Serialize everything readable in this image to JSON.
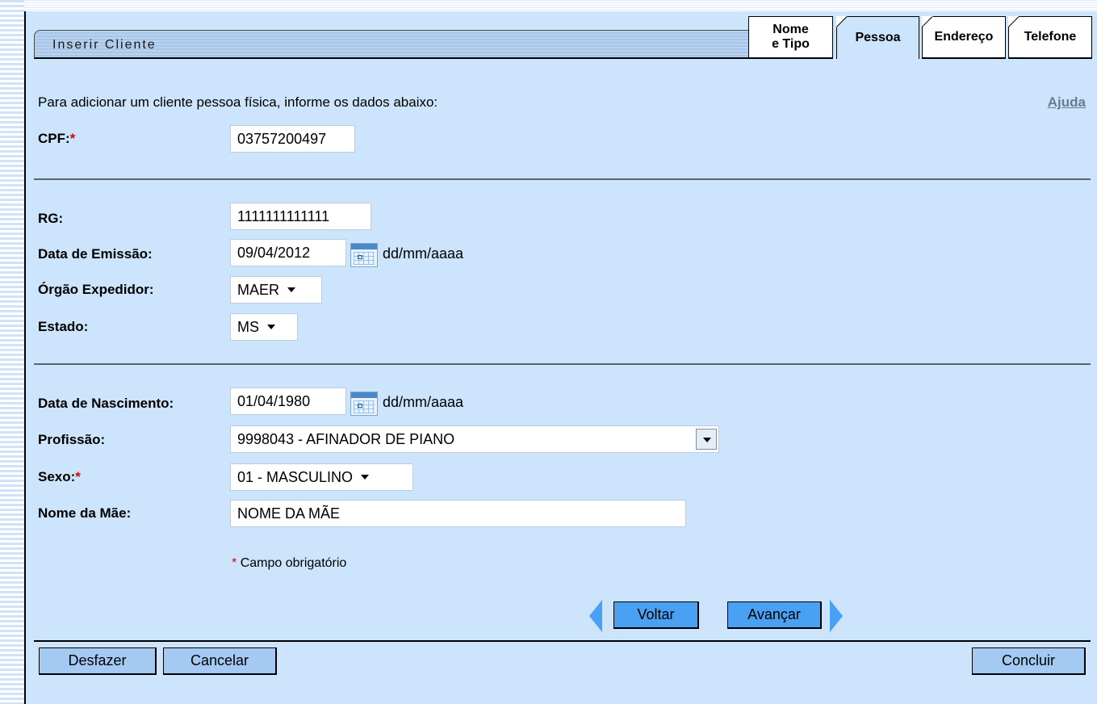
{
  "header": {
    "title": "Inserir Cliente"
  },
  "tabs": [
    {
      "label_line1": "Nome",
      "label_line2": "e Tipo",
      "active": false
    },
    {
      "label": "Pessoa",
      "active": true
    },
    {
      "label": "Endereço",
      "active": false
    },
    {
      "label": "Telefone",
      "active": false
    }
  ],
  "intro": "Para adicionar um cliente pessoa física, informe os dados abaixo:",
  "help_link": "Ajuda",
  "required_mark": "*",
  "fields": {
    "cpf": {
      "label": "CPF:",
      "value": "03757200497"
    },
    "rg": {
      "label": "RG:",
      "value": "1111111111111"
    },
    "data_emissao": {
      "label": "Data de Emissão:",
      "value": "09/04/2012",
      "format": "dd/mm/aaaa"
    },
    "orgao_expedidor": {
      "label": "Órgão Expedidor:",
      "value": "MAER"
    },
    "estado": {
      "label": "Estado:",
      "value": "MS"
    },
    "data_nascimento": {
      "label": "Data de Nascimento:",
      "value": "01/04/1980",
      "format": "dd/mm/aaaa"
    },
    "profissao": {
      "label": "Profissão:",
      "value": "9998043 - AFINADOR DE PIANO"
    },
    "sexo": {
      "label": "Sexo:",
      "value": "01 - MASCULINO"
    },
    "nome_mae": {
      "label": "Nome da Mãe:",
      "value": "NOME DA MÃE"
    }
  },
  "required_note": "Campo obrigatório",
  "nav": {
    "back": "Voltar",
    "next": "Avançar"
  },
  "footer": {
    "undo": "Desfazer",
    "cancel": "Cancelar",
    "finish": "Concluir"
  },
  "icons": [
    "calendar-icon",
    "chevron-down-icon",
    "arrow-left-icon",
    "arrow-right-icon"
  ],
  "colors": {
    "panel": "#cce4fc",
    "button": "#a4caf4",
    "nav_button": "#4aa0f2",
    "required": "#e00000"
  }
}
